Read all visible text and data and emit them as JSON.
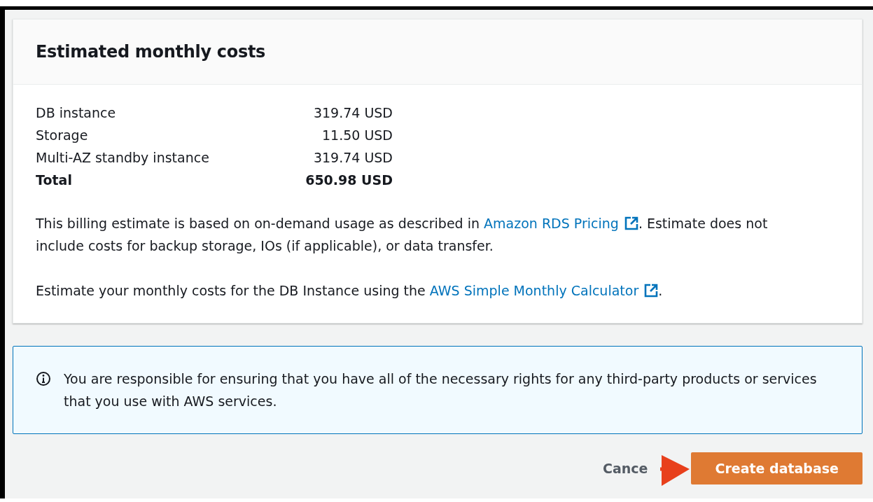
{
  "panel": {
    "title": "Estimated monthly costs",
    "costs": [
      {
        "label": "DB instance",
        "value": "319.74 USD",
        "total": false
      },
      {
        "label": "Storage",
        "value": "11.50 USD",
        "total": false
      },
      {
        "label": "Multi-AZ standby instance",
        "value": "319.74 USD",
        "total": false
      },
      {
        "label": "Total",
        "value": "650.98 USD",
        "total": true
      }
    ],
    "notes": [
      [
        {
          "kind": "text",
          "text": "This billing estimate is based on on-demand usage as described in "
        },
        {
          "kind": "link",
          "text": "Amazon RDS Pricing"
        },
        {
          "kind": "text",
          "text": ". Estimate does not include costs for backup storage, IOs (if applicable), or data transfer."
        }
      ],
      [
        {
          "kind": "text",
          "text": "Estimate your monthly costs for the DB Instance using the "
        },
        {
          "kind": "link",
          "text": "AWS Simple Monthly Calculator"
        },
        {
          "kind": "text",
          "text": "."
        }
      ]
    ]
  },
  "notice": {
    "text": "You are responsible for ensuring that you have all of the necessary rights for any third-party products or services that you use with AWS services."
  },
  "buttons": [
    {
      "label": "Cance",
      "kind": "secondary"
    },
    {
      "label": "Create database",
      "kind": "primary"
    }
  ]
}
